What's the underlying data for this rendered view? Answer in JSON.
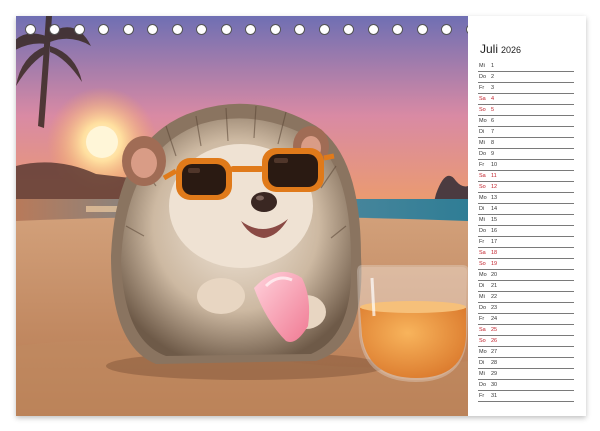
{
  "calendar": {
    "month": "Juli",
    "year": "2026",
    "accent_color": "#c0202a",
    "days": [
      {
        "wd": "Mi",
        "d": "1",
        "weekend": false
      },
      {
        "wd": "Do",
        "d": "2",
        "weekend": false
      },
      {
        "wd": "Fr",
        "d": "3",
        "weekend": false
      },
      {
        "wd": "Sa",
        "d": "4",
        "weekend": true
      },
      {
        "wd": "So",
        "d": "5",
        "weekend": true
      },
      {
        "wd": "Mo",
        "d": "6",
        "weekend": false
      },
      {
        "wd": "Di",
        "d": "7",
        "weekend": false
      },
      {
        "wd": "Mi",
        "d": "8",
        "weekend": false
      },
      {
        "wd": "Do",
        "d": "9",
        "weekend": false
      },
      {
        "wd": "Fr",
        "d": "10",
        "weekend": false
      },
      {
        "wd": "Sa",
        "d": "11",
        "weekend": true
      },
      {
        "wd": "So",
        "d": "12",
        "weekend": true
      },
      {
        "wd": "Mo",
        "d": "13",
        "weekend": false
      },
      {
        "wd": "Di",
        "d": "14",
        "weekend": false
      },
      {
        "wd": "Mi",
        "d": "15",
        "weekend": false
      },
      {
        "wd": "Do",
        "d": "16",
        "weekend": false
      },
      {
        "wd": "Fr",
        "d": "17",
        "weekend": false
      },
      {
        "wd": "Sa",
        "d": "18",
        "weekend": true
      },
      {
        "wd": "So",
        "d": "19",
        "weekend": true
      },
      {
        "wd": "Mo",
        "d": "20",
        "weekend": false
      },
      {
        "wd": "Di",
        "d": "21",
        "weekend": false
      },
      {
        "wd": "Mi",
        "d": "22",
        "weekend": false
      },
      {
        "wd": "Do",
        "d": "23",
        "weekend": false
      },
      {
        "wd": "Fr",
        "d": "24",
        "weekend": false
      },
      {
        "wd": "Sa",
        "d": "25",
        "weekend": true
      },
      {
        "wd": "So",
        "d": "26",
        "weekend": true
      },
      {
        "wd": "Mo",
        "d": "27",
        "weekend": false
      },
      {
        "wd": "Di",
        "d": "28",
        "weekend": false
      },
      {
        "wd": "Mi",
        "d": "29",
        "weekend": false
      },
      {
        "wd": "Do",
        "d": "30",
        "weekend": false
      },
      {
        "wd": "Fr",
        "d": "31",
        "weekend": false
      }
    ]
  }
}
